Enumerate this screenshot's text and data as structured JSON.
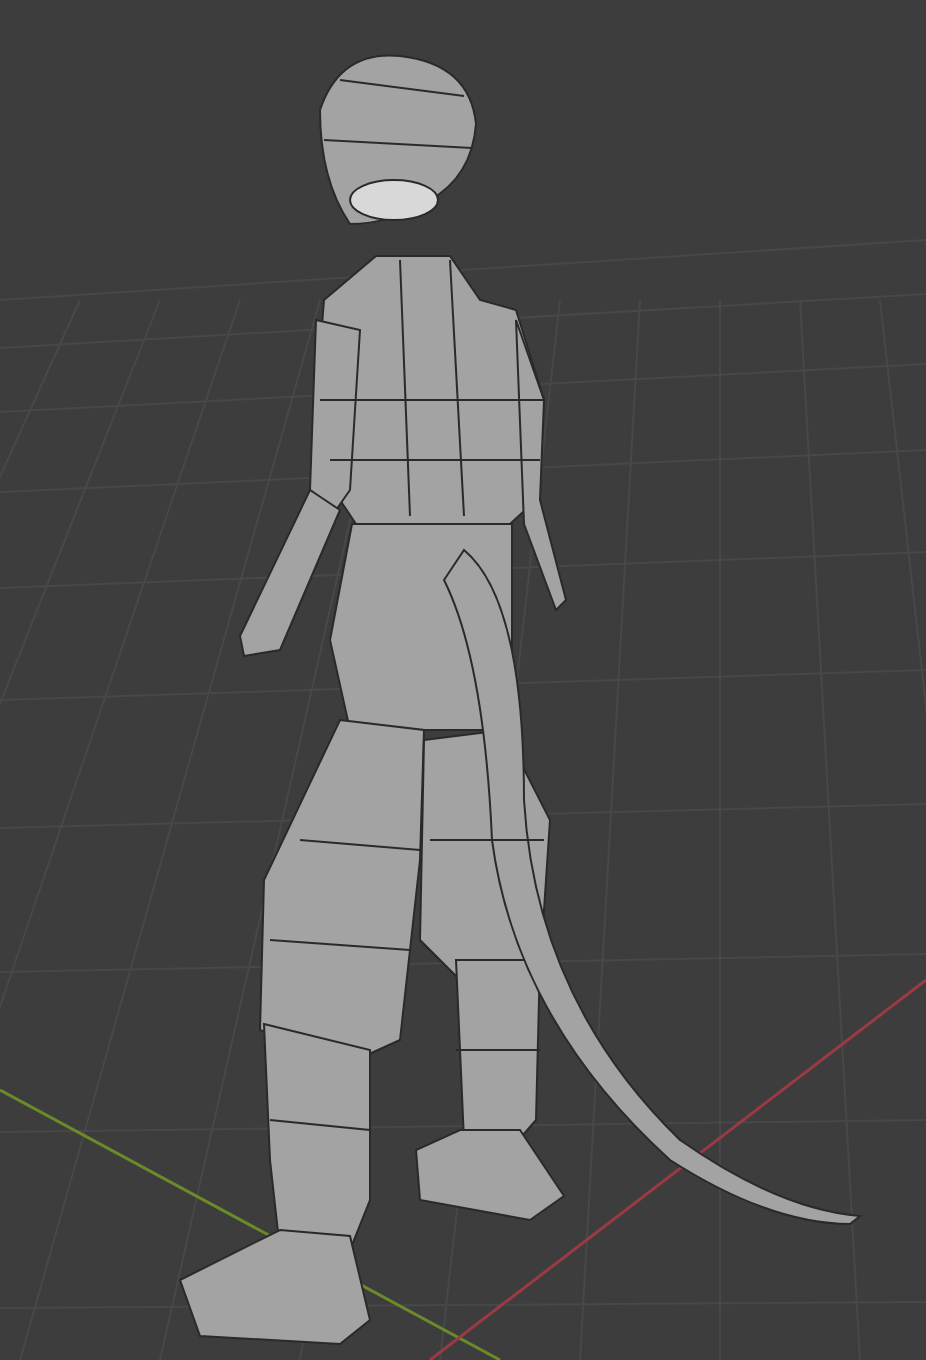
{
  "viewport": {
    "grid": true,
    "x_axis": true,
    "y_axis": true
  }
}
